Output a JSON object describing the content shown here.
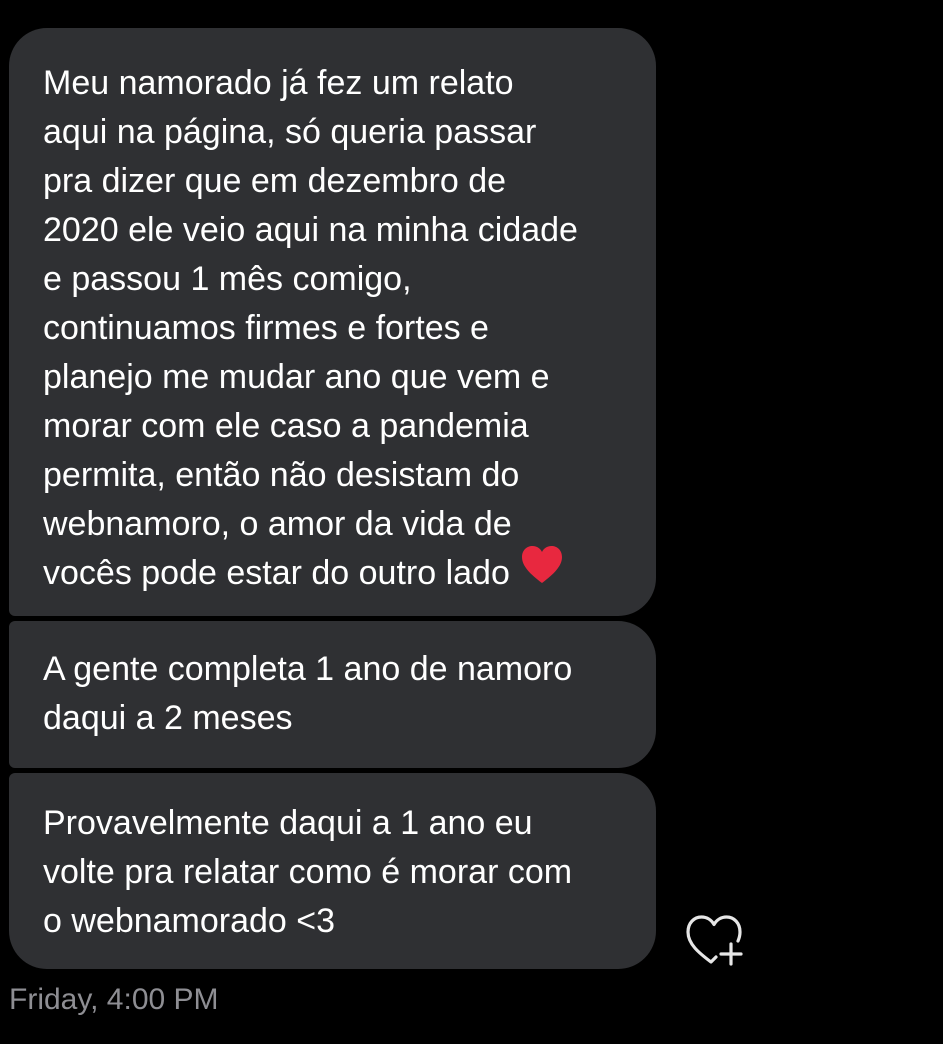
{
  "messages": [
    {
      "lines": [
        "Meu namorado já fez um relato",
        "aqui na página, só queria passar",
        "pra dizer que em dezembro de",
        "2020 ele veio aqui na minha cidade",
        "e passou 1 mês comigo,",
        "continuamos firmes e fortes e",
        "planejo me mudar ano que vem e",
        "morar com ele caso a pandemia",
        "permita, então não desistam do",
        "webnamoro, o amor da vida de",
        "vocês pode estar do outro lado"
      ],
      "emoji": "red-heart-icon"
    },
    {
      "lines": [
        "A gente completa 1 ano de namoro",
        "daqui a 2 meses"
      ]
    },
    {
      "lines": [
        "Provavelmente daqui a 1 ano eu",
        "volte pra relatar como é morar com",
        "o webnamorado <3"
      ]
    }
  ],
  "reaction_button": {
    "icon": "heart-plus-icon"
  },
  "timestamp": "Friday, 4:00 PM",
  "colors": {
    "background": "#000000",
    "bubble": "#2f3033",
    "text": "#ffffff",
    "timestamp": "#8e8e93",
    "heart": "#e8283f"
  }
}
